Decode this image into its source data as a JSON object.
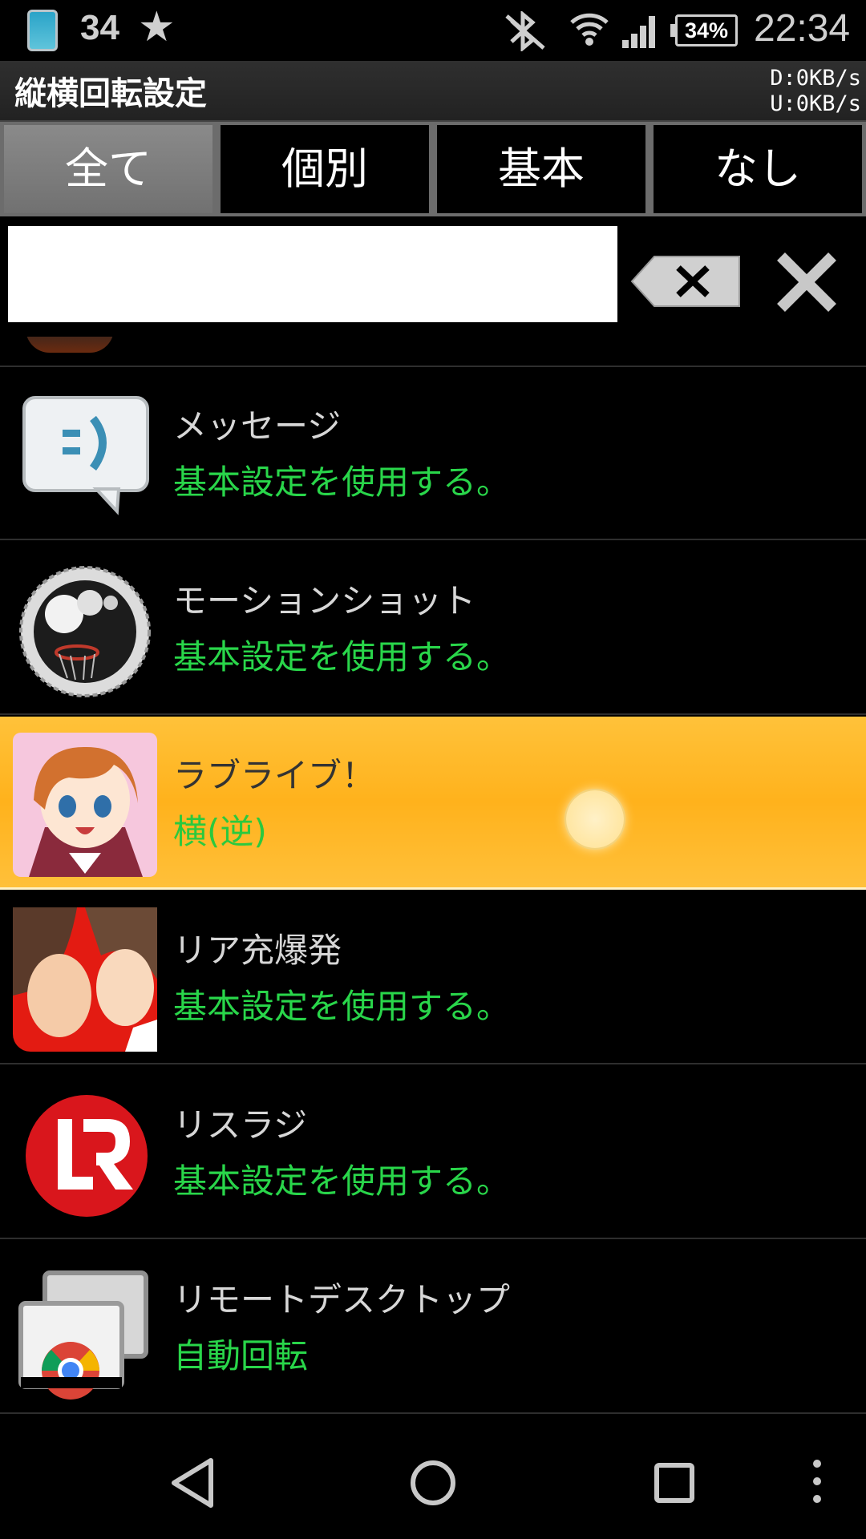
{
  "status_bar": {
    "notification_count": "34",
    "battery_percent": "34%",
    "time": "22:34"
  },
  "title_bar": {
    "title": "縦横回転設定",
    "download_speed": "D:0KB/s",
    "upload_speed": "U:0KB/s"
  },
  "tabs": [
    {
      "label": "全て",
      "active": true
    },
    {
      "label": "個別",
      "active": false
    },
    {
      "label": "基本",
      "active": false
    },
    {
      "label": "なし",
      "active": false
    }
  ],
  "search": {
    "value": "",
    "placeholder": ""
  },
  "apps": [
    {
      "name": "メッセージ",
      "setting": "基本設定を使用する。",
      "icon": "message-icon"
    },
    {
      "name": "モーションショット",
      "setting": "基本設定を使用する。",
      "icon": "motion-shot-icon"
    },
    {
      "name": "ラブライブ！",
      "setting": "横(逆)",
      "icon": "love-live-icon",
      "selected": true
    },
    {
      "name": "リア充爆発",
      "setting": "基本設定を使用する。",
      "icon": "riajuu-icon"
    },
    {
      "name": "リスラジ",
      "setting": "基本設定を使用する。",
      "icon": "lisradi-icon"
    },
    {
      "name": "リモートデスクトップ",
      "setting": "自動回転",
      "icon": "remote-desktop-icon"
    }
  ],
  "colors": {
    "background": "#000000",
    "setting_text": "#29d64a",
    "selected_row": "#ffb21c"
  }
}
